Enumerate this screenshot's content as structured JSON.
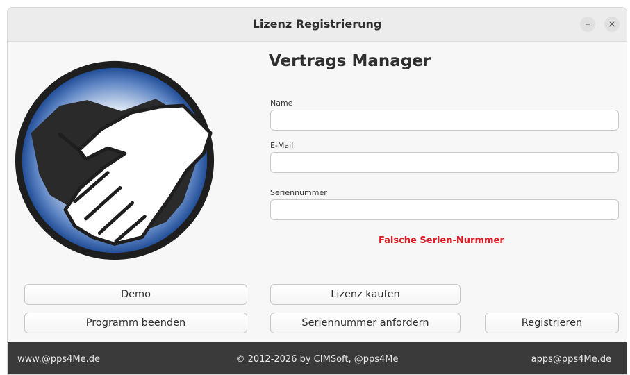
{
  "window": {
    "title": "Lizenz Registrierung",
    "minimize_glyph": "–",
    "close_glyph": "×"
  },
  "logo": {
    "icon": "handshake-logo",
    "colors": {
      "ring": "#1e1e1e",
      "blue": "#2f5fa8",
      "hand_dark": "#2a2a2a",
      "hand_light": "#ffffff"
    }
  },
  "app_title": "Vertrags Manager",
  "form": {
    "name_label": "Name",
    "name_value": "",
    "email_label": "E-Mail",
    "email_value": "",
    "serial_label": "Seriennummer",
    "serial_value": ""
  },
  "error_message": "Falsche Serien-Nurmmer",
  "error_color": "#e01b24",
  "buttons": {
    "demo": "Demo",
    "buy": "Lizenz kaufen",
    "quit": "Programm beenden",
    "request_serial": "Seriennummer anfordern",
    "register": "Registrieren"
  },
  "footer": {
    "website": "www.@pps4Me.de",
    "copyright": "© 2012-2026 by CIMSoft, @pps4Me",
    "email": "apps@pps4Me.de"
  }
}
